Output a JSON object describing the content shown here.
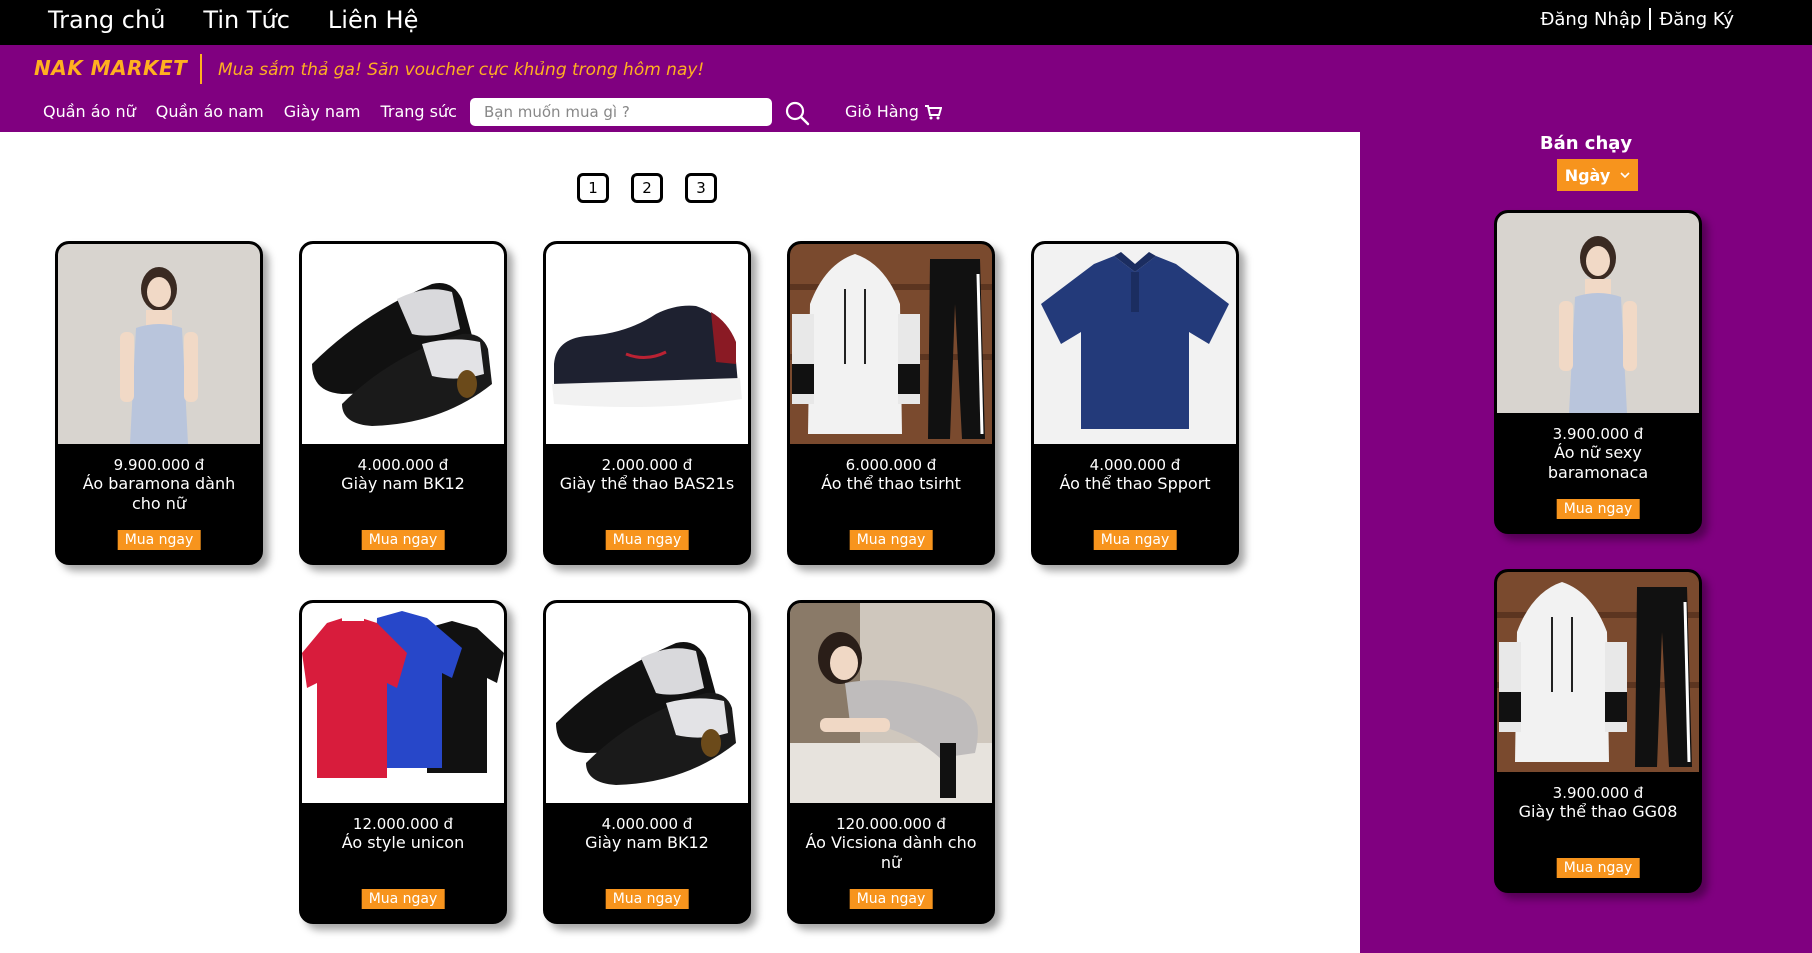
{
  "topnav": {
    "items": [
      "Trang chủ",
      "Tin Tức",
      "Liên Hệ"
    ],
    "login": "Đăng Nhập",
    "register": "Đăng Ký"
  },
  "brand": {
    "logo": "NAK MARKET",
    "slogan": "Mua sắm thả ga! Săn voucher cực khủng trong hôm nay!"
  },
  "categories": [
    "Quần áo nữ",
    "Quần áo nam",
    "Giày nam",
    "Trang sức"
  ],
  "search": {
    "placeholder": "Bạn muốn mua gì ?"
  },
  "cart": {
    "label": "Giỏ Hàng"
  },
  "pagination": [
    "1",
    "2",
    "3"
  ],
  "products": [
    {
      "price": "9.900.000 đ",
      "name": "Áo baramona dành cho nữ",
      "buy": "Mua ngay",
      "image": "woman-dress"
    },
    {
      "price": "4.000.000 đ",
      "name": "Giày nam BK12",
      "buy": "Mua ngay",
      "image": "leather-shoes"
    },
    {
      "price": "2.000.000 đ",
      "name": "Giày thể thao BAS21s",
      "buy": "Mua ngay",
      "image": "sneaker"
    },
    {
      "price": "6.000.000 đ",
      "name": "Áo thể thao tsirht",
      "buy": "Mua ngay",
      "image": "hoodie-set"
    },
    {
      "price": "4.000.000 đ",
      "name": "Áo thể thao Spport",
      "buy": "Mua ngay",
      "image": "polo-blue"
    },
    {
      "price": "12.000.000 đ",
      "name": "Áo style unicon",
      "buy": "Mua ngay",
      "image": "polo-three"
    },
    {
      "price": "4.000.000 đ",
      "name": "Giày nam BK12",
      "buy": "Mua ngay",
      "image": "leather-shoes"
    },
    {
      "price": "120.000.000 đ",
      "name": "Áo Vicsiona dành cho nữ",
      "buy": "Mua ngay",
      "image": "woman-pose"
    }
  ],
  "sidebar": {
    "title": "Bán chạy",
    "filter": "Ngày",
    "items": [
      {
        "price": "3.900.000 đ",
        "name": "Áo nữ sexy baramonaca",
        "buy": "Mua ngay",
        "image": "woman-dress"
      },
      {
        "price": "3.900.000 đ",
        "name": "Giày thể thao GG08",
        "buy": "Mua ngay",
        "image": "hoodie-set"
      }
    ]
  },
  "colors": {
    "purple": "#800080",
    "orange": "#f7941d",
    "black": "#000000"
  }
}
